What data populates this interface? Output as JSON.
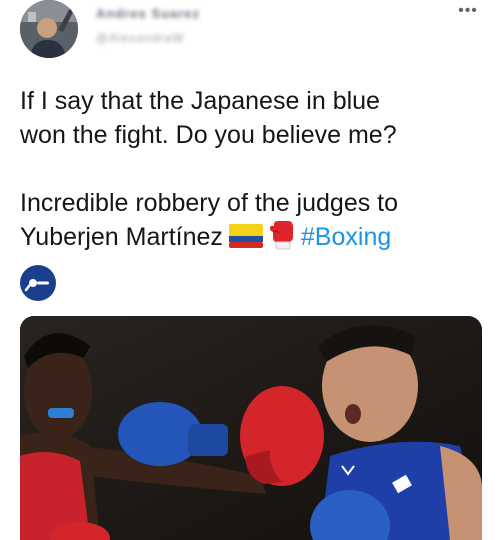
{
  "tweet": {
    "author": {
      "name": "Andres Suarez",
      "handle": "@AlexandraW"
    },
    "text_line1": "If I say that the Japanese in blue",
    "text_line2": "won the fight. Do you believe me?",
    "text_line3": "Incredible robbery of the judges to",
    "text_line4_name": "Yuberjen Martínez",
    "hashtag": "#Boxing",
    "icons": [
      "colombia-flag-icon",
      "boxing-glove-icon",
      "boxing-pictogram-icon",
      "more-options-icon"
    ]
  },
  "colors": {
    "hashtag": "#1b95e0",
    "text": "#14171a",
    "emblem": "#1a3f8c"
  }
}
